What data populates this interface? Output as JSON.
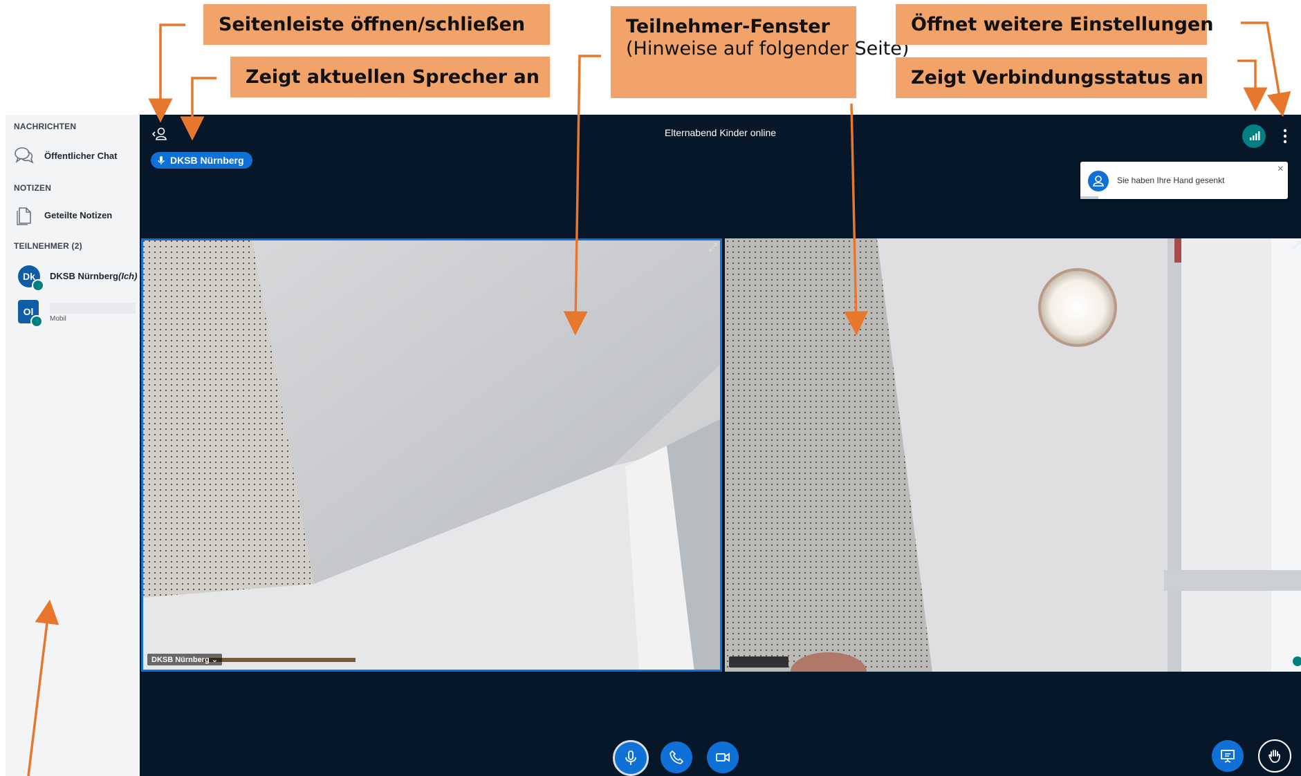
{
  "callouts": {
    "sidebar_toggle": "Seitenleiste öffnen/schließen",
    "current_speaker": "Zeigt aktuellen Sprecher an",
    "participant_window_title": "Teilnehmer-Fenster",
    "participant_window_note": "(Hinweise auf folgender Seite)",
    "more_settings": "Öffnet weitere Einstellungen",
    "connection_status": "Zeigt Verbindungsstatus an"
  },
  "sidebar": {
    "messages_heading": "NACHRICHTEN",
    "public_chat": "Öffentlicher Chat",
    "notes_heading": "NOTIZEN",
    "shared_notes": "Geteilte Notizen",
    "participants_heading": "TEILNEHMER (2)",
    "participants": [
      {
        "initials": "Dk",
        "name": "DKSB Nürnberg",
        "suffix": "(Ich)"
      },
      {
        "initials": "Ol",
        "name": "",
        "suffix": "Mobil"
      }
    ]
  },
  "meeting": {
    "title": "Elternabend Kinder online",
    "current_speaker": "DKSB Nürnberg",
    "toast_message": "Sie haben Ihre Hand gesenkt",
    "toast_close": "×"
  },
  "videos": [
    {
      "label": "DKSB Nürnberg ⌄"
    },
    {
      "label": ""
    }
  ],
  "icons": {
    "sidebar_toggle": "user-chevron-icon",
    "chat": "chat-bubbles-icon",
    "notes": "document-icon",
    "connection": "signal-bars-icon",
    "more": "vertical-dots-icon",
    "mic": "microphone-icon",
    "phone": "phone-icon",
    "camera": "video-camera-icon",
    "presentation": "presentation-icon",
    "raise_hand": "hand-icon"
  },
  "colors": {
    "callout": "#f1a36a",
    "arrow": "#e8772e",
    "main_bg": "#06172a",
    "accent_blue": "#0f70d7",
    "status_green": "#008081"
  }
}
